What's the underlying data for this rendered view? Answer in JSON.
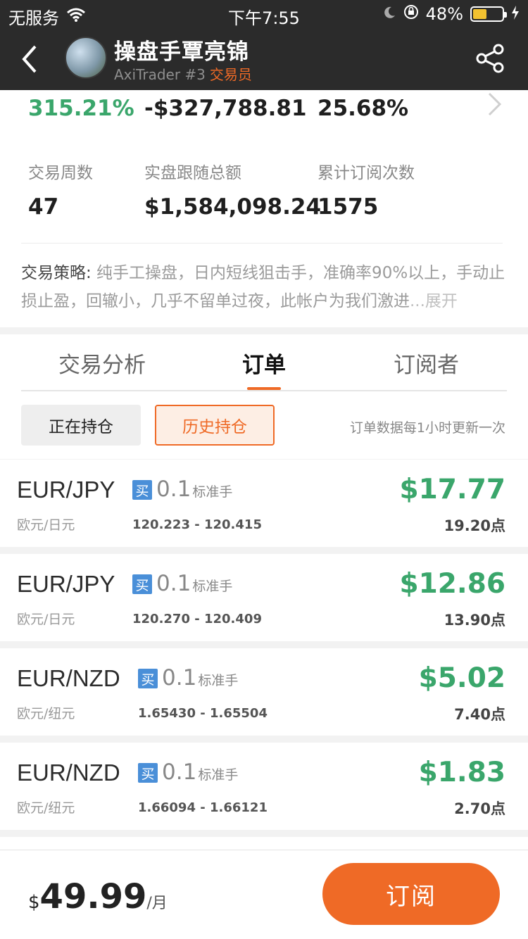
{
  "status_bar": {
    "carrier": "无服务",
    "time": "下午7:55",
    "battery": "48%",
    "battery_level": 0.48
  },
  "header": {
    "title": "操盘手覃亮锦",
    "subtitle": "AxiTrader #3",
    "role": "交易员"
  },
  "stats": {
    "row1": [
      "315.21%",
      "-$327,788.81",
      "25.68%"
    ],
    "labels2": [
      "交易周数",
      "实盘跟随总额",
      "累计订阅次数"
    ],
    "row2": [
      "47",
      "$1,584,098.24",
      "1575"
    ]
  },
  "strategy": {
    "label": "交易策略:",
    "text": " 纯手工操盘，日内短线狙击手，准确率90%以上，手动止损止盈，回辙小，几乎不留单过夜，此帐户为我们激进",
    "more": "...展开"
  },
  "tabs": [
    "交易分析",
    "订单",
    "订阅者"
  ],
  "filters": {
    "open": "正在持仓",
    "history": "历史持仓",
    "note": "订单数据每1小时更新一次"
  },
  "orders": [
    {
      "pair": "EUR/JPY",
      "pair_cn": "欧元/日元",
      "side": "买",
      "lot": "0.1",
      "unit": "标准手",
      "range": "120.223 - 120.415",
      "profit": "$17.77",
      "points": "19.20点"
    },
    {
      "pair": "EUR/JPY",
      "pair_cn": "欧元/日元",
      "side": "买",
      "lot": "0.1",
      "unit": "标准手",
      "range": "120.270 - 120.409",
      "profit": "$12.86",
      "points": "13.90点"
    },
    {
      "pair": "EUR/NZD",
      "pair_cn": "欧元/纽元",
      "side": "买",
      "lot": "0.1",
      "unit": "标准手",
      "range": "1.65430 - 1.65504",
      "profit": "$5.02",
      "points": "7.40点"
    },
    {
      "pair": "EUR/NZD",
      "pair_cn": "欧元/纽元",
      "side": "买",
      "lot": "0.1",
      "unit": "标准手",
      "range": "1.66094 - 1.66121",
      "profit": "$1.83",
      "points": "2.70点"
    }
  ],
  "bottom": {
    "currency": "$",
    "price": "49.99",
    "period": "/月",
    "subscribe": "订阅"
  },
  "colors": {
    "accent": "#ef6a26",
    "profit": "#3aa66b",
    "buy": "#4a8fd8"
  }
}
